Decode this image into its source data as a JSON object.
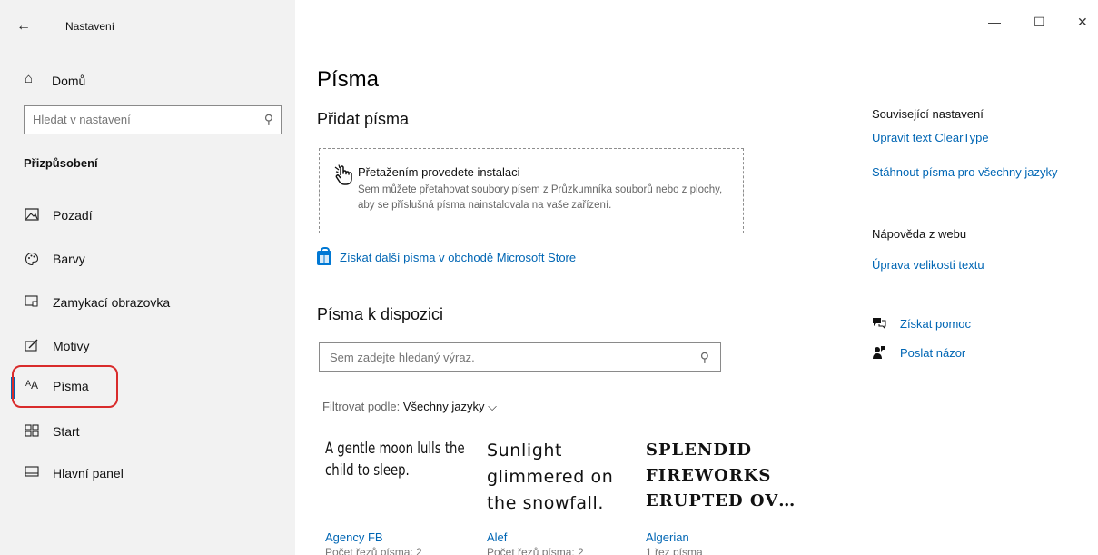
{
  "app": {
    "title": "Nastavení",
    "back_icon": "back-arrow-icon"
  },
  "window_controls": {
    "minimize": "—",
    "maximize": "☐",
    "close": "✕"
  },
  "sidebar": {
    "home_label": "Domů",
    "search_placeholder": "Hledat v nastavení",
    "section_title": "Přizpůsobení",
    "items": [
      {
        "label": "Pozadí",
        "icon": "picture-icon",
        "glyph": "⛶"
      },
      {
        "label": "Barvy",
        "icon": "palette-icon",
        "glyph": "🎨"
      },
      {
        "label": "Zamykací obrazovka",
        "icon": "lock-screen-icon",
        "glyph": "▭"
      },
      {
        "label": "Motivy",
        "icon": "brush-icon",
        "glyph": "✎"
      },
      {
        "label": "Písma",
        "icon": "font-icon",
        "glyph": "ᴬA",
        "active": true
      },
      {
        "label": "Start",
        "icon": "start-tiles-icon",
        "glyph": "▦"
      },
      {
        "label": "Hlavní panel",
        "icon": "taskbar-icon",
        "glyph": "▭"
      }
    ],
    "accent_color": "#0063b1",
    "highlight_color": "#d92b2b"
  },
  "main": {
    "page_title": "Písma",
    "add_fonts_heading": "Přidat písma",
    "drop_zone": {
      "title": "Přetažením provedete instalaci",
      "description": "Sem můžete přetahovat soubory písem z Průzkumníka souborů nebo z plochy, aby se příslušná písma nainstalovala na vaše zařízení."
    },
    "store_link": "Získat další písma v obchodě Microsoft Store",
    "available_heading": "Písma k dispozici",
    "font_search_placeholder": "Sem zadejte hledaný výraz.",
    "filter": {
      "label": "Filtrovat podle:",
      "value": "Všechny jazyky"
    },
    "fonts": [
      {
        "preview": "A gentle moon lulls the child to sleep.",
        "name": "Agency FB",
        "meta": "Počet řezů písma: 2"
      },
      {
        "preview": "Sunlight glimmered on the snowfall.",
        "name": "Alef",
        "meta": "Počet řezů písma: 2"
      },
      {
        "preview": "Splendid fireworks erupted ov…",
        "name": "Algerian",
        "meta": "1 řez písma"
      }
    ]
  },
  "related": {
    "heading": "Související nastavení",
    "links": [
      "Upravit text ClearType",
      "Stáhnout písma pro všechny jazyky"
    ],
    "web_help_heading": "Nápověda z webu",
    "web_links": [
      "Úprava velikosti textu"
    ],
    "help": "Získat pomoc",
    "feedback": "Poslat názor"
  },
  "link_color": "#0066b4"
}
